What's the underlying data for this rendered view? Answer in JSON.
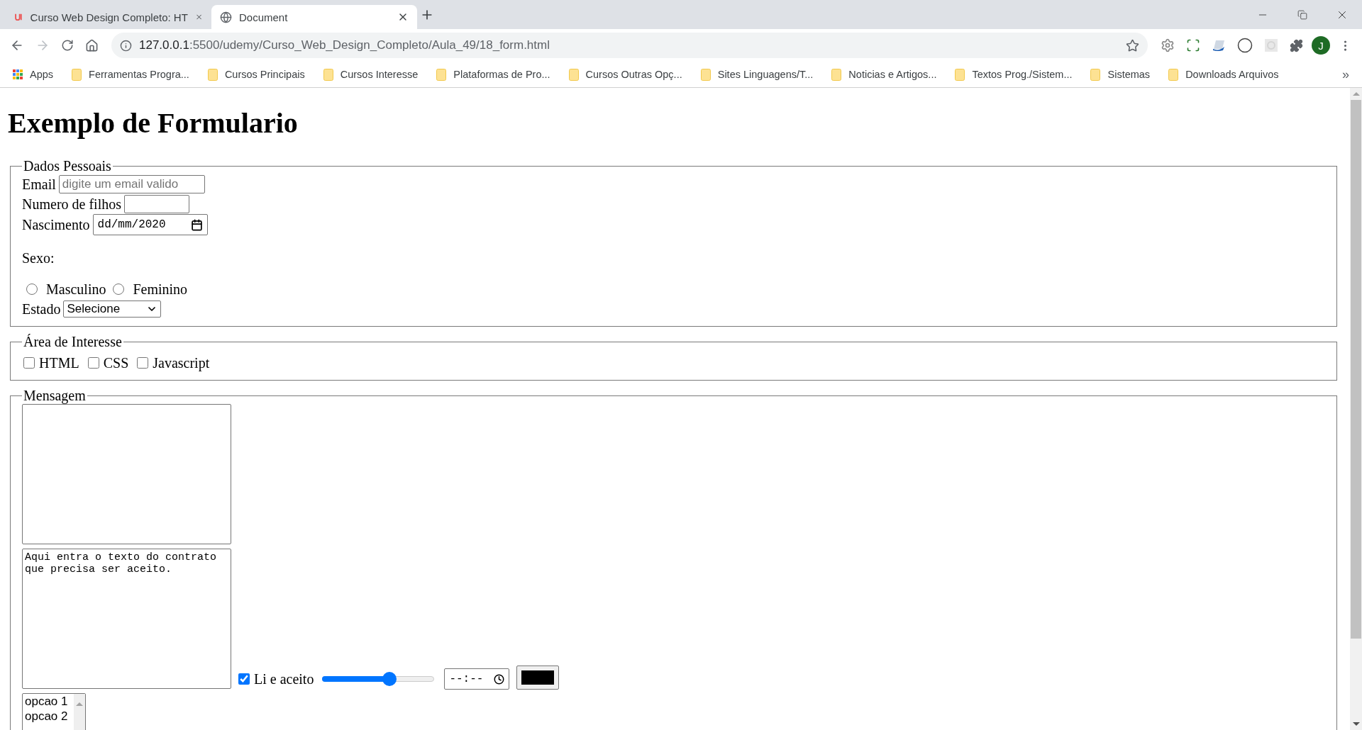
{
  "browser": {
    "tabs": [
      {
        "title": "Curso Web Design Completo: HT",
        "kind": "udemy",
        "selected": false
      },
      {
        "title": "Document",
        "kind": "globe",
        "selected": true
      }
    ],
    "address": {
      "host": "127.0.0.1",
      "path": ":5500/udemy/Curso_Web_Design_Completo/Aula_49/18_form.html"
    },
    "profile_initial": "J",
    "bookmarks": [
      {
        "label": "Apps",
        "kind": "apps"
      },
      {
        "label": "Ferramentas Progra...",
        "kind": "folder"
      },
      {
        "label": "Cursos Principais",
        "kind": "folder"
      },
      {
        "label": "Cursos Interesse",
        "kind": "folder"
      },
      {
        "label": "Plataformas de Pro...",
        "kind": "folder"
      },
      {
        "label": "Cursos Outras Opç...",
        "kind": "folder"
      },
      {
        "label": "Sites Linguagens/T...",
        "kind": "folder"
      },
      {
        "label": "Noticias e Artigos...",
        "kind": "folder"
      },
      {
        "label": "Textos Prog./Sistem...",
        "kind": "folder"
      },
      {
        "label": "Sistemas",
        "kind": "folder"
      },
      {
        "label": "Downloads Arquivos",
        "kind": "folder"
      }
    ],
    "bookmarks_more": "»"
  },
  "page": {
    "heading": "Exemplo de Formulario",
    "personal": {
      "legend": "Dados Pessoais",
      "email": {
        "label": "Email",
        "placeholder": "digite um email valido"
      },
      "children": {
        "label": "Numero de filhos"
      },
      "birth": {
        "label": "Nascimento",
        "value": "dd/mm/2020"
      },
      "sex": {
        "label": "Sexo:",
        "options": [
          {
            "label": "Masculino",
            "selected": false
          },
          {
            "label": "Feminino",
            "selected": false
          }
        ]
      },
      "state": {
        "label": "Estado",
        "value": "Selecione"
      }
    },
    "interests": {
      "legend": "Área de Interesse",
      "options": [
        {
          "label": "HTML",
          "checked": false
        },
        {
          "label": "CSS",
          "checked": false
        },
        {
          "label": "Javascript",
          "checked": false
        }
      ]
    },
    "message": {
      "legend": "Mensagem",
      "contract": "Aqui entra o texto do contrato que precisa ser aceito.",
      "accept": {
        "label": "Li e aceito",
        "checked": true
      },
      "range": {
        "level": 0.6
      },
      "time": {
        "value": "--:--"
      },
      "list": [
        {
          "label": "opcao 1",
          "selected": false
        },
        {
          "label": "opcao 2",
          "selected": false
        }
      ]
    }
  }
}
